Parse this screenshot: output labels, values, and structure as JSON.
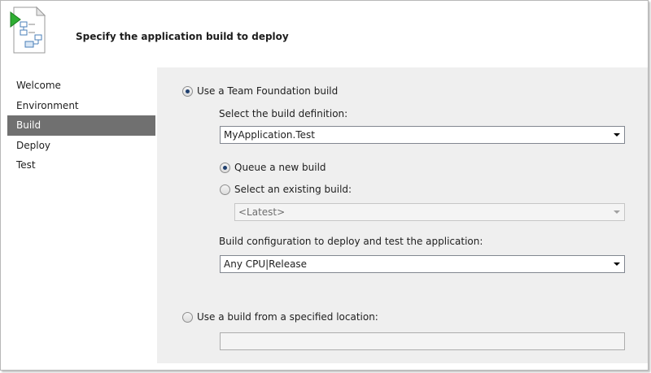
{
  "header": {
    "title": "Specify the application build to deploy",
    "icon": "deploy-wizard-icon"
  },
  "sidebar": {
    "items": [
      {
        "label": "Welcome",
        "active": false
      },
      {
        "label": "Environment",
        "active": false
      },
      {
        "label": "Build",
        "active": true
      },
      {
        "label": "Deploy",
        "active": false
      },
      {
        "label": "Test",
        "active": false
      }
    ],
    "active_color": "#707070"
  },
  "content": {
    "tfs_build": {
      "label": "Use a Team Foundation build",
      "selected": true
    },
    "build_definition": {
      "label": "Select the build definition:",
      "value": "MyApplication.Test"
    },
    "queue_new": {
      "label": "Queue a new build",
      "selected": true
    },
    "existing_build": {
      "label": "Select an existing build:",
      "selected": false,
      "value": "<Latest>",
      "enabled": false
    },
    "configuration": {
      "label": "Build configuration to deploy and test the application:",
      "value": "Any CPU|Release"
    },
    "specified_location": {
      "label": "Use a build from a specified location:",
      "selected": false,
      "value": ""
    }
  },
  "colors": {
    "panel_background": "#efefef",
    "radio_dot": "#1f3f6e"
  }
}
